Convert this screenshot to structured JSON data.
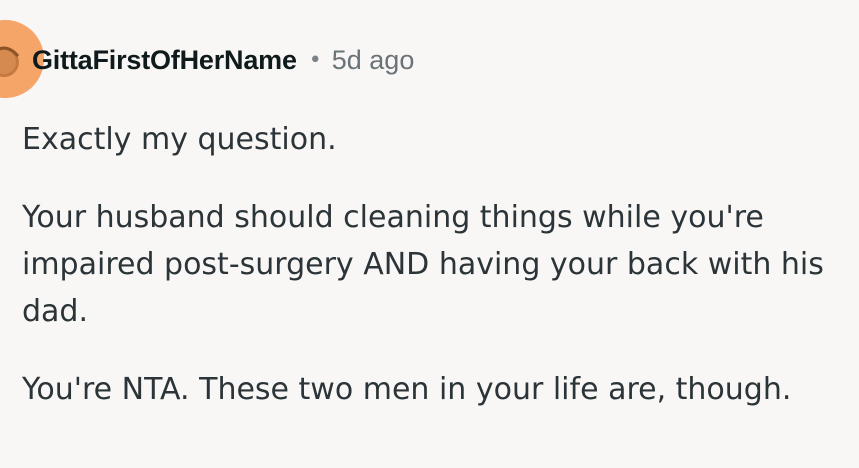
{
  "comment": {
    "author": "GittaFirstOfHerName",
    "separator": "•",
    "timestamp": "5d ago",
    "paragraphs": [
      "Exactly my question.",
      "Your husband should cleaning things while you're impaired post-surgery AND having your back with his dad.",
      "You're NTA. These two men in your life are, though."
    ],
    "avatar_icon": "user-avatar-icon"
  },
  "colors": {
    "background": "#f9f7f5",
    "avatar": "#f6a569",
    "username": "#0f1a1c",
    "timestamp": "#6a7377",
    "body_text": "#2b3438"
  }
}
